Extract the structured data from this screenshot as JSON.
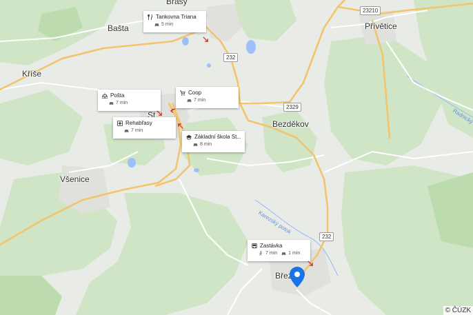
{
  "towns": {
    "brasy": "Brasy",
    "basta": "Bašta",
    "krise": "Kříše",
    "privetice": "Přívětice",
    "bezdekov": "Bezděkov",
    "vsenice": "Všenice",
    "st": "St",
    "brez": "Břez"
  },
  "road_badges": {
    "r23210": "23210",
    "r232_top": "232",
    "r2329": "2329",
    "r232_bottom": "232"
  },
  "river_labels": {
    "karezsky": "Karezský potok",
    "radnicky": "Radnický"
  },
  "poi_cards": [
    {
      "icon": "restaurant-icon",
      "name": "Tankovna Triana",
      "times": [
        {
          "mode": "car-icon",
          "value": "5 min"
        }
      ]
    },
    {
      "icon": "post-office-icon",
      "name": "Pošta",
      "times": [
        {
          "mode": "car-icon",
          "value": "7 min"
        }
      ]
    },
    {
      "icon": "shopping-cart-icon",
      "name": "Coop",
      "times": [
        {
          "mode": "car-icon",
          "value": "7 min"
        }
      ]
    },
    {
      "icon": "medical-cross-icon",
      "name": "Rehabřasy",
      "times": [
        {
          "mode": "car-icon",
          "value": "7 min"
        }
      ]
    },
    {
      "icon": "school-icon",
      "name": "Základní škola St...",
      "times": [
        {
          "mode": "car-icon",
          "value": "8 min"
        }
      ]
    },
    {
      "icon": "bus-icon",
      "name": "Zastávka",
      "times": [
        {
          "mode": "walk-icon",
          "value": "7 min"
        },
        {
          "mode": "car-icon",
          "value": "1 min"
        }
      ]
    }
  ],
  "copyright": "© ČÚZK",
  "colors": {
    "background": "#e8ebe6",
    "forest": "#cde6c4",
    "road_major": "#f3c769",
    "road_minor": "#ffffff",
    "water": "#8ab4f8",
    "pin": "#1a73e8",
    "arrow": "#d93025"
  }
}
